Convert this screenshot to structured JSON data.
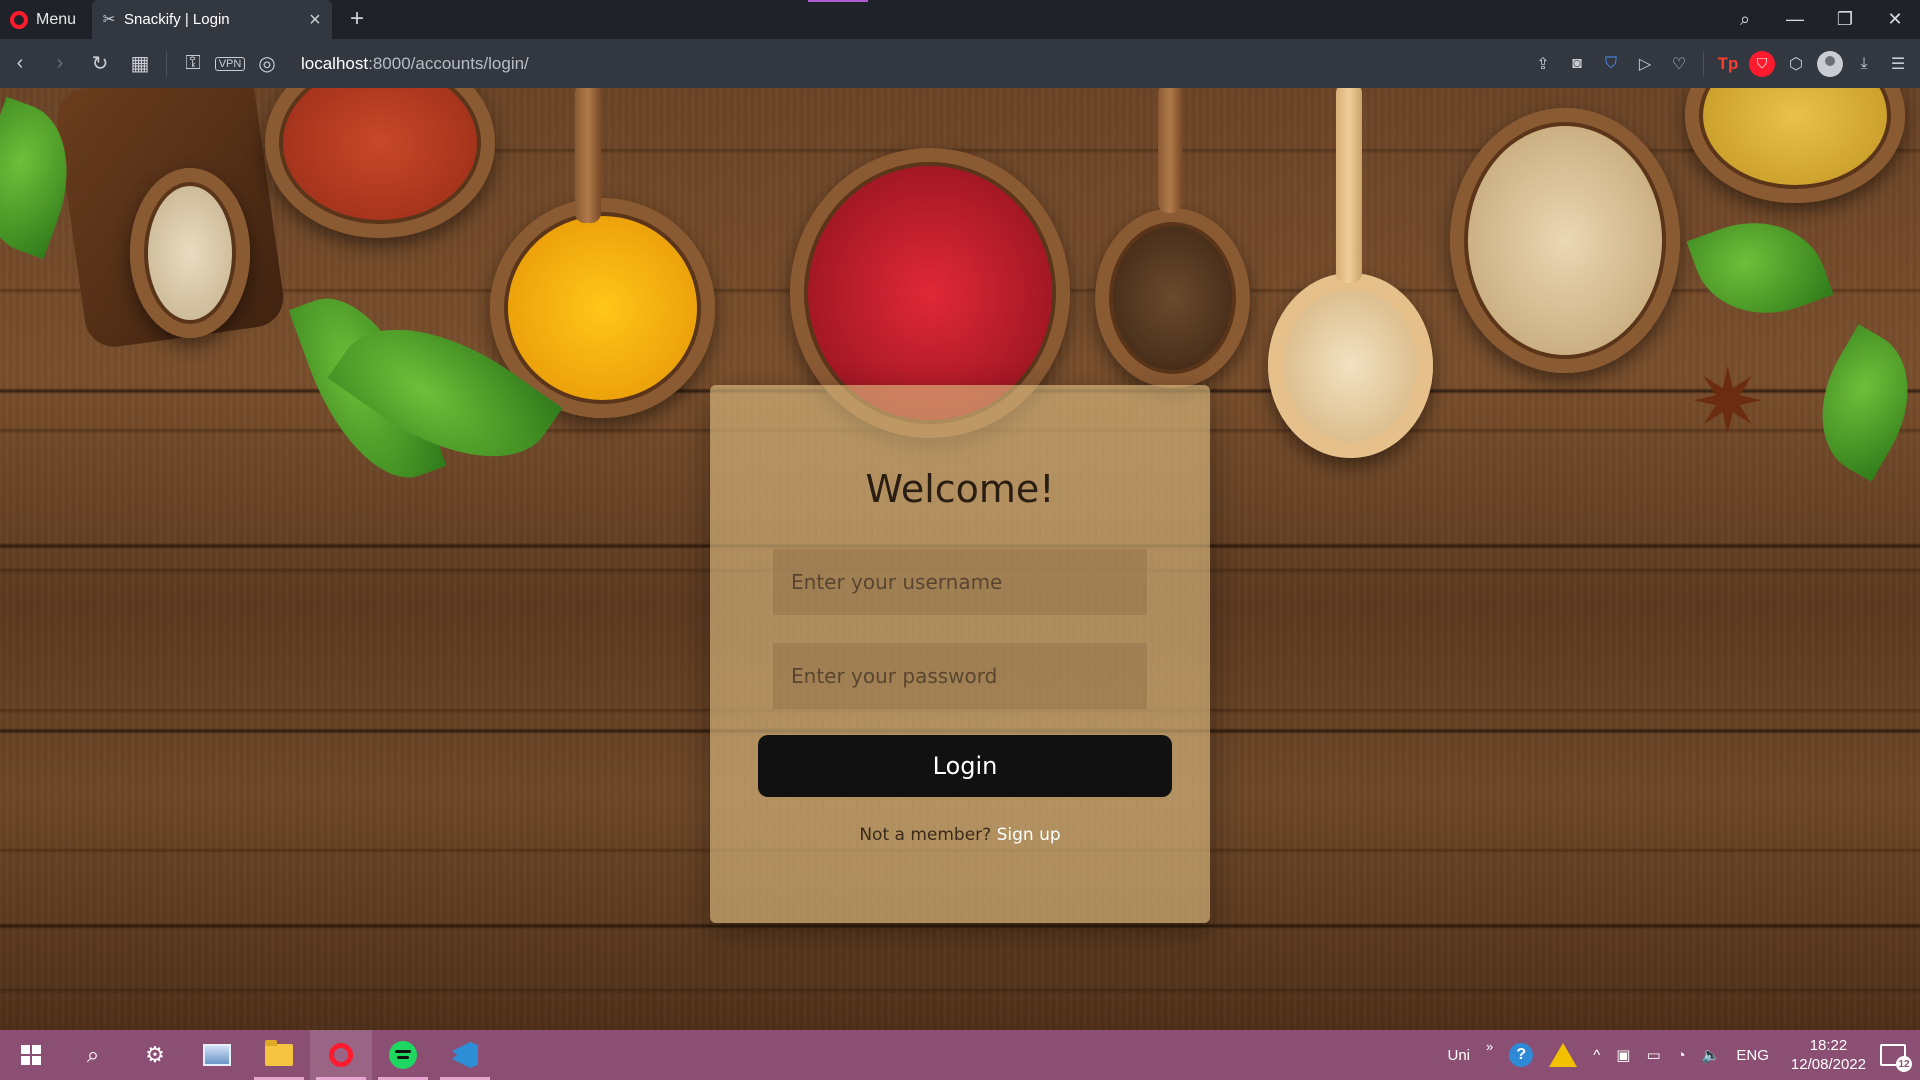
{
  "browser": {
    "menu_label": "Menu",
    "tab": {
      "title": "Snackify | Login"
    },
    "new_tab_symbol": "+",
    "url_host": "localhost",
    "url_path": ":8000/accounts/login/",
    "vpn_label": "VPN",
    "pinboard_label": "Tp"
  },
  "page": {
    "heading": "Welcome!",
    "username_placeholder": "Enter your username",
    "password_placeholder": "Enter your password",
    "login_label": "Login",
    "signup_prompt": "Not a member?",
    "signup_link": "Sign up"
  },
  "taskbar": {
    "tray_lang_short": "Uni",
    "tray_lang": "ENG",
    "time": "18:22",
    "date": "12/08/2022",
    "notification_count": "12"
  },
  "colors": {
    "accent": "#8c4f74",
    "button": "#111111",
    "opera_red": "#ff1b2d"
  }
}
